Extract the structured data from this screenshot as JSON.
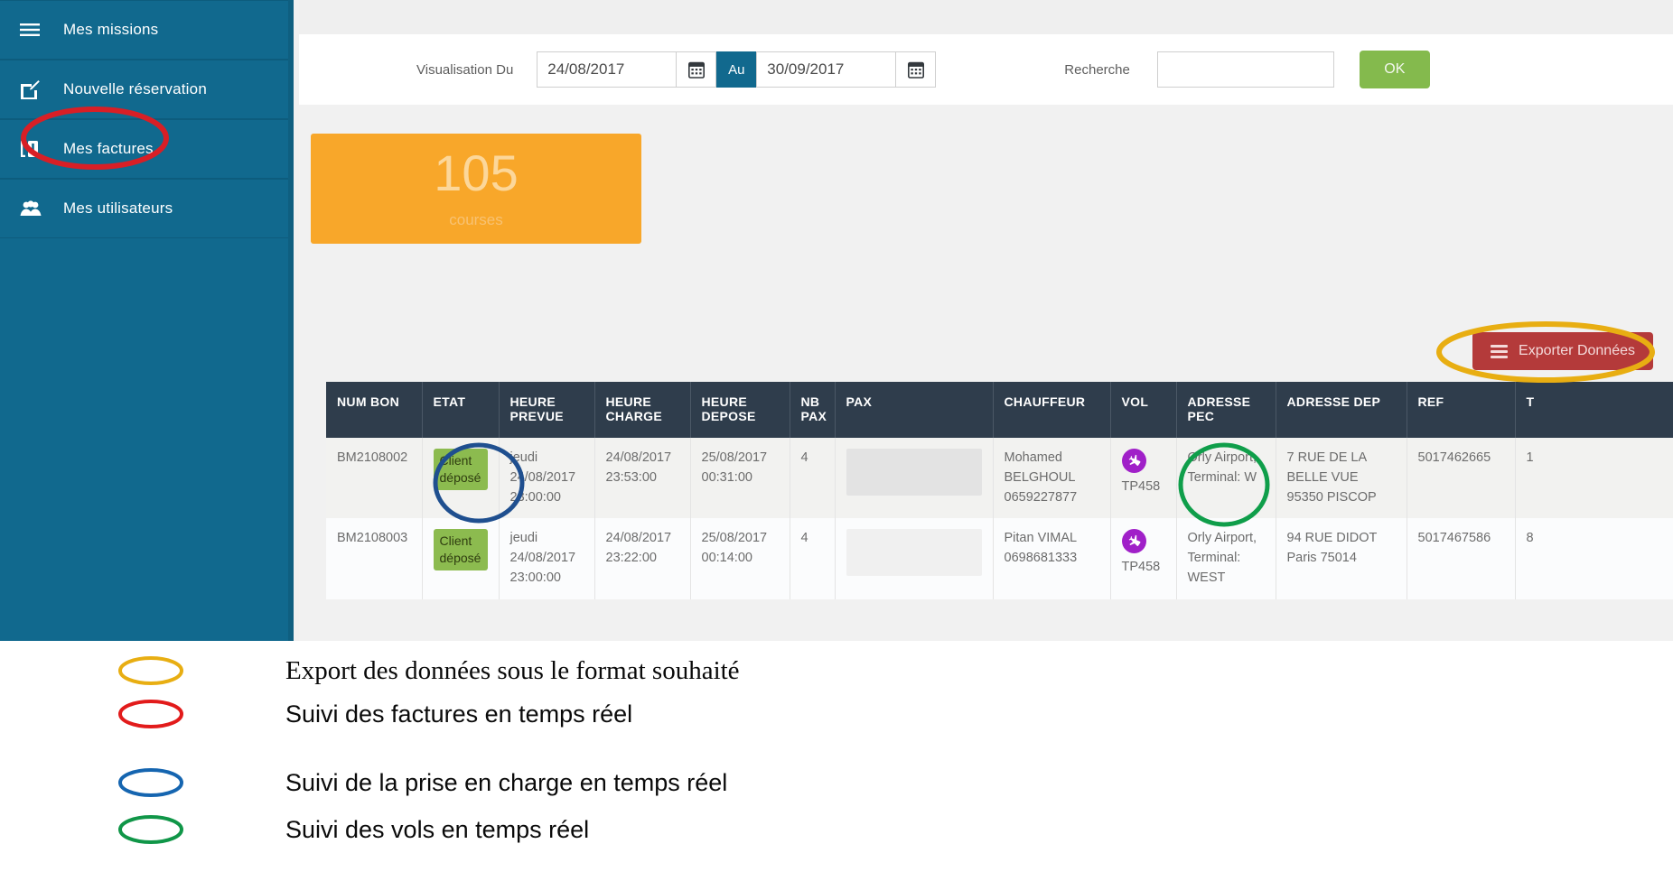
{
  "sidebar": {
    "items": [
      {
        "label": "Mes missions",
        "icon": "hamburger-icon"
      },
      {
        "label": "Nouvelle réservation",
        "icon": "edit-square-icon"
      },
      {
        "label": "Mes factures",
        "icon": "invoice-icon"
      },
      {
        "label": "Mes utilisateurs",
        "icon": "users-icon"
      }
    ]
  },
  "filter_bar": {
    "visualisation_label": "Visualisation Du",
    "date_from": "24/08/2017",
    "au_label": "Au",
    "date_to": "30/09/2017",
    "calendar_icon": "calendar-icon",
    "recherche_label": "Recherche",
    "search_value": "",
    "search_placeholder": "",
    "ok_label": "OK"
  },
  "stat_card": {
    "value": "105",
    "label": "courses"
  },
  "export_button": {
    "label": "Exporter Données",
    "icon": "hamburger-icon"
  },
  "table": {
    "columns": [
      "NUM BON",
      "ETAT",
      "HEURE PREVUE",
      "HEURE CHARGE",
      "HEURE DEPOSE",
      "NB PAX",
      "PAX",
      "CHAUFFEUR",
      "VOL",
      "ADRESSE PEC",
      "ADRESSE DEP",
      "REF",
      "T"
    ],
    "rows": [
      {
        "num_bon": "BM2108002",
        "etat": "Client déposé",
        "heure_prevue": "jeudi 24/08/2017 23:00:00",
        "heure_charge": "24/08/2017 23:53:00",
        "heure_depose": "25/08/2017 00:31:00",
        "nb_pax": "4",
        "pax": "",
        "chauffeur": "Mohamed BELGHOUL 0659227877",
        "vol": "TP458",
        "vol_icon": "plane-icon",
        "adresse_pec": "Orly Airport, Terminal: W",
        "adresse_dep": "7 RUE DE LA BELLE VUE 95350 PISCOP",
        "ref": "5017462665",
        "t": "1"
      },
      {
        "num_bon": "BM2108003",
        "etat": "Client déposé",
        "heure_prevue": "jeudi 24/08/2017 23:00:00",
        "heure_charge": "24/08/2017 23:22:00",
        "heure_depose": "25/08/2017 00:14:00",
        "nb_pax": "4",
        "pax": "",
        "chauffeur": "Pitan VIMAL 0698681333",
        "vol": "TP458",
        "vol_icon": "plane-icon",
        "adresse_pec": "Orly Airport, Terminal: WEST",
        "adresse_dep": "94 RUE DIDOT Paris 75014",
        "ref": "5017467586",
        "t": "8"
      }
    ]
  },
  "annotations": [
    {
      "color": "#e8ae12",
      "target": "export-button"
    },
    {
      "color": "#d81f26",
      "target": "sidebar-item-mes-factures"
    },
    {
      "color": "#1f4f8f",
      "target": "etat-badge"
    },
    {
      "color": "#0f9e4a",
      "target": "vol-cell"
    }
  ],
  "legend": {
    "rows": [
      {
        "color": "#e8ae12",
        "text": "Export des données sous le format souhaité",
        "style": "serif"
      },
      {
        "color": "#e21b1b",
        "text": "Suivi des factures en temps réel",
        "style": "sans"
      },
      {
        "color": "#1565b0",
        "text": "Suivi de la prise en charge en temps réel",
        "style": "sans"
      },
      {
        "color": "#109648",
        "text": "Suivi des vols en temps réel",
        "style": "sans"
      }
    ]
  },
  "colors": {
    "sidebar_bg": "#11698e",
    "table_header_bg": "#2f3d4c",
    "stat_card_bg": "#f8a72a",
    "export_btn_bg": "#b43a3a",
    "ok_btn_bg": "#84ba4d",
    "badge_bg": "#8cbb4f",
    "plane_badge_bg": "#a020c8",
    "link_color": "#5b9bc4"
  }
}
